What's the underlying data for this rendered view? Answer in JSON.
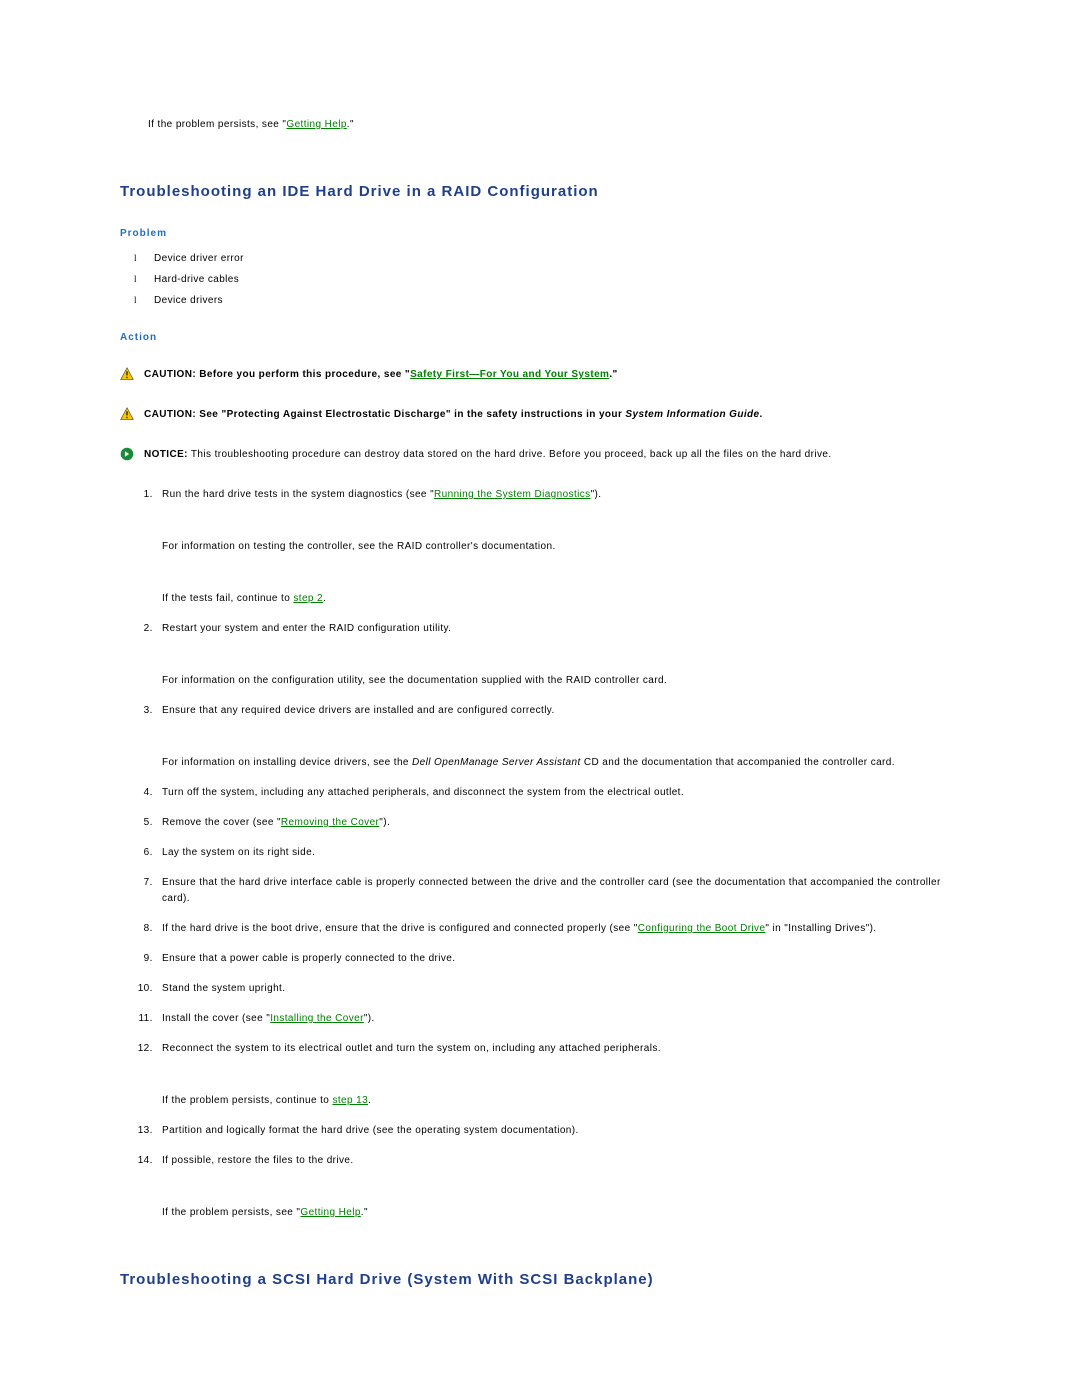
{
  "intro": {
    "persist_prefix": "If the problem persists, see \"",
    "persist_link": "Getting Help",
    "persist_suffix": ".\""
  },
  "section1": {
    "heading": "Troubleshooting an IDE Hard Drive in a RAID Configuration",
    "problem_heading": "Problem",
    "problems": [
      "Device driver error",
      "Hard-drive cables",
      "Device drivers"
    ],
    "action_heading": "Action",
    "caution1": {
      "label": "CAUTION:",
      "before": " Before you perform this procedure, see \"",
      "link": "Safety First—For You and Your System",
      "after": ".\""
    },
    "caution2": {
      "label": "CAUTION:",
      "before": " See \"Protecting Against Electrostatic Discharge\" in the safety instructions in your ",
      "italic": "System Information Guide",
      "after": "."
    },
    "notice": {
      "label": "NOTICE:",
      "text": " This troubleshooting procedure can destroy data stored on the hard drive. Before you proceed, back up all the files on the hard drive."
    },
    "steps": {
      "s1": {
        "before": "Run the hard drive tests in the system diagnostics (see \"",
        "link": "Running the System Diagnostics",
        "after": "\").",
        "aux1": "For information on testing the controller, see the RAID controller's documentation.",
        "aux2_before": "If the tests fail, continue to ",
        "aux2_link": "step 2",
        "aux2_after": "."
      },
      "s2": {
        "text": "Restart your system and enter the RAID configuration utility.",
        "aux1": "For information on the configuration utility, see the documentation supplied with the RAID controller card."
      },
      "s3": {
        "text": "Ensure that any required device drivers are installed and are configured correctly.",
        "aux1_before": "For information on installing device drivers, see the ",
        "aux1_italic": "Dell OpenManage Server Assistant",
        "aux1_after": " CD and the documentation that accompanied the controller card."
      },
      "s4": "Turn off the system, including any attached peripherals, and disconnect the system from the electrical outlet.",
      "s5": {
        "before": "Remove the cover (see \"",
        "link": "Removing the Cover",
        "after": "\")."
      },
      "s6": "Lay the system on its right side.",
      "s7": "Ensure that the hard drive interface cable is properly connected between the drive and the controller card (see the documentation that accompanied the controller card).",
      "s8": {
        "before": "If the hard drive is the boot drive, ensure that the drive is configured and connected properly (see \"",
        "link": "Configuring the Boot Drive",
        "after": "\" in \"Installing Drives\")."
      },
      "s9": "Ensure that a power cable is properly connected to the drive.",
      "s10": "Stand the system upright.",
      "s11": {
        "before": "Install the cover (see \"",
        "link": "Installing the Cover",
        "after": "\")."
      },
      "s12": {
        "text": "Reconnect the system to its electrical outlet and turn the system on, including any attached peripherals.",
        "aux_before": "If the problem persists, continue to ",
        "aux_link": "step 13",
        "aux_after": "."
      },
      "s13": "Partition and logically format the hard drive (see the operating system documentation).",
      "s14": {
        "text": "If possible, restore the files to the drive.",
        "aux_before": "If the problem persists, see \"",
        "aux_link": "Getting Help",
        "aux_after": ".\""
      }
    }
  },
  "section2": {
    "heading": "Troubleshooting a SCSI Hard Drive (System With SCSI Backplane)"
  }
}
